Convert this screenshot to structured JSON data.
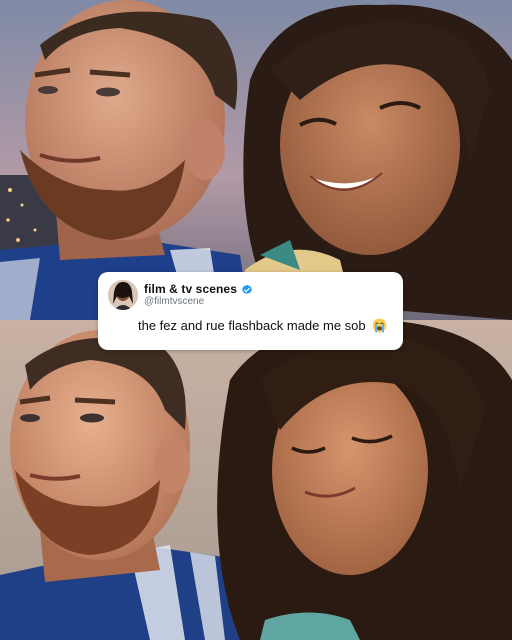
{
  "tweet": {
    "display_name": "film & tv scenes",
    "handle": "@filmtvscene",
    "text": "the fez and rue flashback made me sob",
    "emoji": "crying-face-icon",
    "verified_icon": "verified-badge-icon",
    "verified_color": "#1d9bf0"
  },
  "photos": [
    {
      "name": "top-photo",
      "description_key": "couple-smiling-dusk"
    },
    {
      "name": "bottom-photo",
      "description_key": "couple-eyes-closed"
    }
  ]
}
